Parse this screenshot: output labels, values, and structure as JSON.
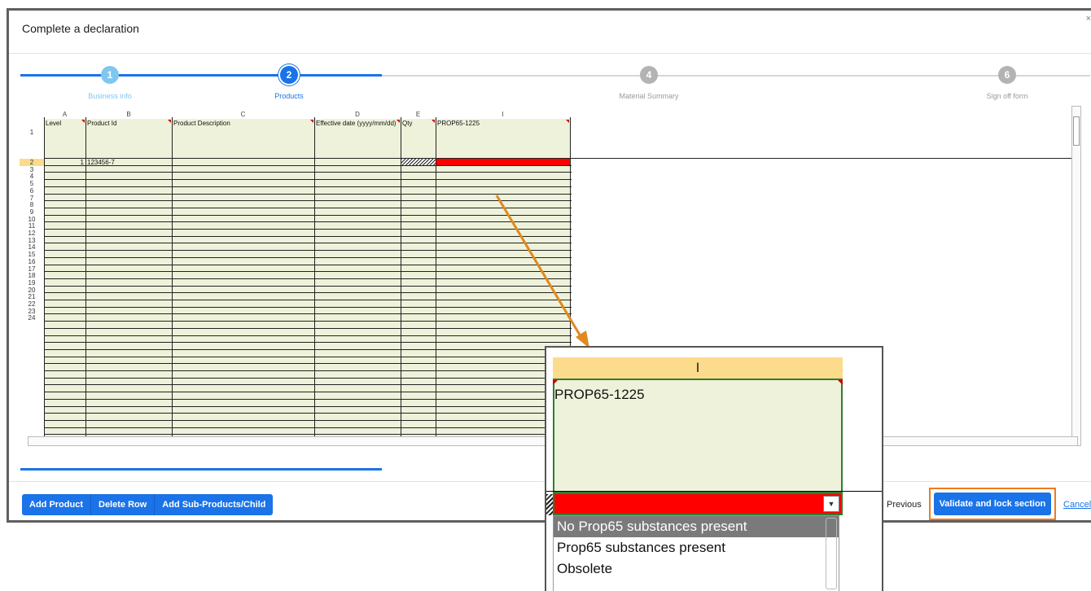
{
  "dialog": {
    "title": "Complete a declaration",
    "close_glyph": "×"
  },
  "stepper": {
    "steps": [
      {
        "number": "1",
        "label": "Business info",
        "state": "done"
      },
      {
        "number": "2",
        "label": "Products",
        "state": "active"
      },
      {
        "number": "4",
        "label": "Material Summary",
        "state": "todo"
      },
      {
        "number": "6",
        "label": "Sign off form",
        "state": "todo"
      }
    ]
  },
  "sheet": {
    "columns": [
      "A",
      "B",
      "C",
      "D",
      "E",
      "I"
    ],
    "headers": [
      "Level",
      "Product Id",
      "Product Description",
      "Effective date (yyyy/mm/dd)",
      "Qty",
      "PROP65-1225"
    ],
    "row_numbers": [
      "1",
      "2",
      "3",
      "4",
      "5",
      "6",
      "7",
      "8",
      "9",
      "10",
      "11",
      "12",
      "13",
      "14",
      "15",
      "16",
      "17",
      "18",
      "19",
      "20",
      "21",
      "22",
      "23",
      "24"
    ],
    "row2": {
      "level": "1",
      "product_id": "123456-7"
    }
  },
  "toolbar": {
    "add_product": "Add Product",
    "delete_row": "Delete Row",
    "add_sub": "Add Sub-Products/Child"
  },
  "nav": {
    "previous": "Previous",
    "validate": "Validate and lock section",
    "cancel": "Cancel"
  },
  "zoom": {
    "column": "I",
    "header": "PROP65-1225",
    "options": [
      "No Prop65 substances present",
      "Prop65 substances present",
      "Obsolete"
    ],
    "selected_index": 0
  },
  "colors": {
    "accent": "#1a73e8",
    "step_done": "#7fc7ef",
    "step_todo": "#b3b3b3",
    "highlight": "#f07b1f",
    "cell_fill": "#eef2da",
    "error_cell": "#ff0000"
  }
}
